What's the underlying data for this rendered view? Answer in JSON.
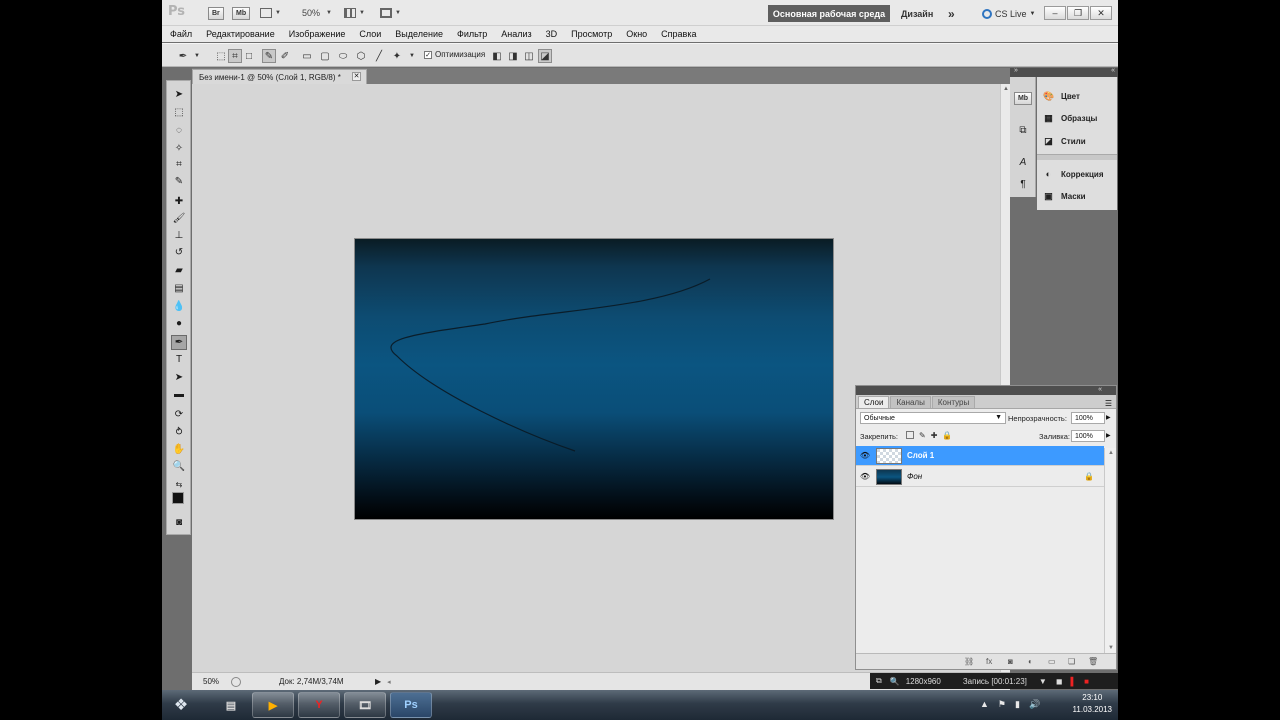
{
  "appbar": {
    "logo": "Ps",
    "br": "Br",
    "mb": "Mb",
    "zoom": "50%",
    "workspace_active": "Основная рабочая среда",
    "workspace_design": "Дизайн",
    "more": "»",
    "cs_live": "CS Live"
  },
  "menu": [
    "Файл",
    "Редактирование",
    "Изображение",
    "Слои",
    "Выделение",
    "Фильтр",
    "Анализ",
    "3D",
    "Просмотр",
    "Окно",
    "Справка"
  ],
  "options": {
    "optimization_label": "Оптимизация"
  },
  "document": {
    "tab_title": "Без имени-1 @ 50% (Слой 1, RGB/8) *",
    "status_zoom": "50%",
    "status_doc": "Док: 2,74M/3,74M"
  },
  "right_panel": {
    "items": [
      "Цвет",
      "Образцы",
      "Стили",
      "Коррекция",
      "Маски"
    ],
    "icon_a": "A",
    "icon_para": "¶"
  },
  "layers": {
    "tabs": [
      "Слои",
      "Каналы",
      "Контуры"
    ],
    "blend_mode": "Обычные",
    "opacity_label": "Непрозрачность:",
    "opacity_value": "100%",
    "lock_label": "Закрепить:",
    "fill_label": "Заливка:",
    "fill_value": "100%",
    "rows": [
      {
        "name": "Слой 1",
        "selected": true
      },
      {
        "name": "Фон",
        "selected": false
      }
    ]
  },
  "recorder": {
    "resolution": "1280x960",
    "recording": "Запись [00:01:23]"
  },
  "taskbar": {
    "ps_label": "Ps",
    "time": "23:10",
    "date": "11.03.2013"
  },
  "colors": {
    "selected_layer": "#3d9aff",
    "workspace_active_bg": "#5e5e5e"
  }
}
